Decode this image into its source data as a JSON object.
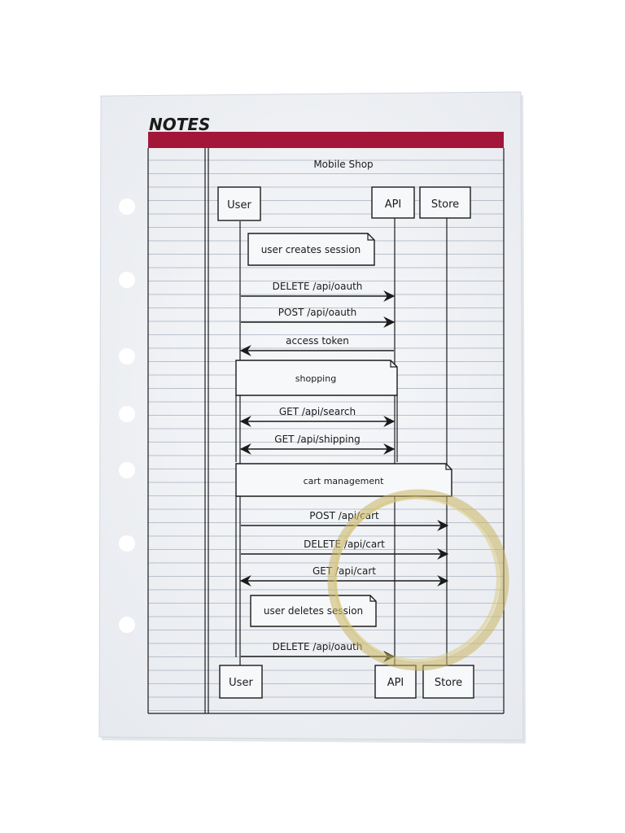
{
  "page": {
    "header": "NOTES",
    "accent_color": "#a3163a",
    "paper_color": "#f4f6f8",
    "rule_color": "#a7b1bf",
    "ink_color": "#1b1b1b",
    "stain_color": "#c9b560"
  },
  "diagram": {
    "title": "Mobile Shop",
    "participants": {
      "user": "User",
      "api": "API",
      "store": "Store"
    },
    "notes": {
      "create_session": "user creates session",
      "delete_session": "user deletes session"
    },
    "groups": {
      "shopping": "shopping",
      "cart": "cart management"
    },
    "messages": [
      {
        "label": "DELETE /api/oauth",
        "from": "User",
        "to": "API",
        "direction": "right"
      },
      {
        "label": "POST /api/oauth",
        "from": "User",
        "to": "API",
        "direction": "right"
      },
      {
        "label": "access token",
        "from": "API",
        "to": "User",
        "direction": "left"
      },
      {
        "label": "GET /api/search",
        "from": "User",
        "to": "API",
        "direction": "both"
      },
      {
        "label": "GET /api/shipping",
        "from": "User",
        "to": "API",
        "direction": "both"
      },
      {
        "label": "POST /api/cart",
        "from": "User",
        "to": "Store",
        "direction": "right"
      },
      {
        "label": "DELETE /api/cart",
        "from": "User",
        "to": "Store",
        "direction": "right"
      },
      {
        "label": "GET /api/cart",
        "from": "User",
        "to": "Store",
        "direction": "both"
      },
      {
        "label": "DELETE /api/oauth",
        "from": "User",
        "to": "API",
        "direction": "right"
      }
    ]
  }
}
